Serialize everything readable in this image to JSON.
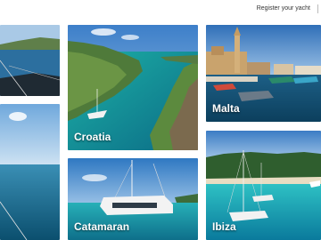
{
  "header": {
    "register_link": "Register your yacht"
  },
  "destinations": [
    {
      "label": ""
    },
    {
      "label": ""
    },
    {
      "label": "Croatia"
    },
    {
      "label": "Catamaran"
    },
    {
      "label": "Malta"
    },
    {
      "label": "Ibiza"
    }
  ],
  "colors": {
    "sea_turquoise": "#1aa6a4",
    "sea_deep": "#0b5f86",
    "sky_blue": "#7fb6e0",
    "label_text": "#ffffff"
  }
}
